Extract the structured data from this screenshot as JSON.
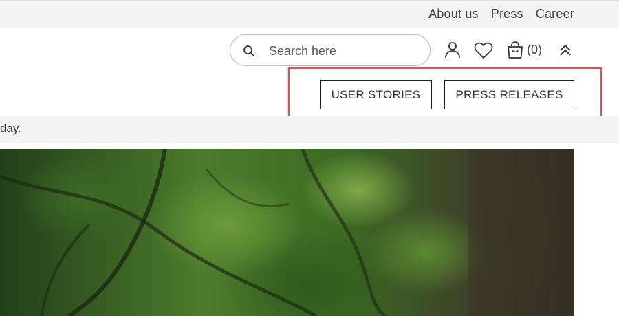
{
  "top_links": {
    "about": "About us",
    "press": "Press",
    "career": "Career"
  },
  "search": {
    "placeholder": "Search here",
    "icon": "search-icon"
  },
  "header_icons": {
    "account": "user-icon",
    "wishlist": "heart-icon",
    "cart": "cart-icon",
    "cart_count": "(0)",
    "collapse": "double-chevron-up-icon"
  },
  "nav_buttons": {
    "user_stories": "USER STORIES",
    "press_releases": "PRESS RELEASES"
  },
  "notice": {
    "text": "day."
  },
  "colors": {
    "highlight_border": "#e05252",
    "topbar_bg": "#f3f3f3"
  }
}
